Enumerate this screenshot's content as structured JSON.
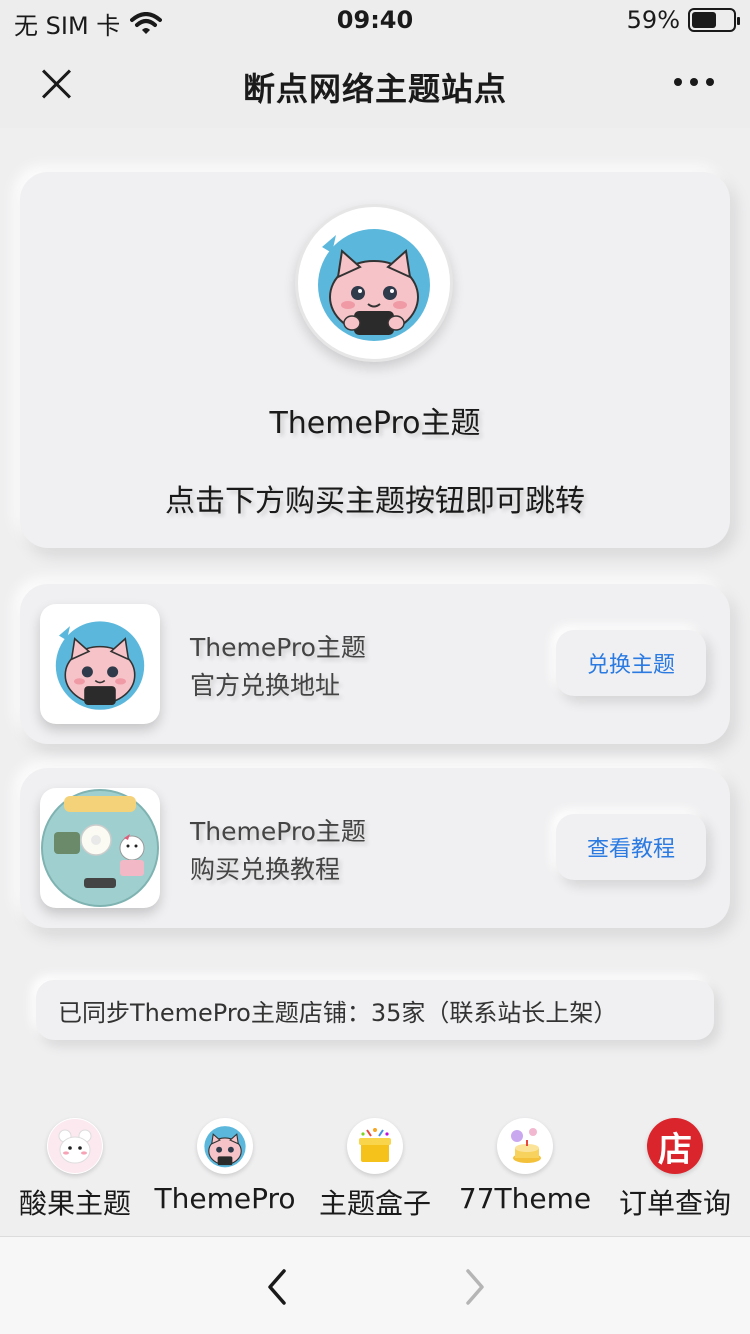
{
  "status_bar": {
    "carrier": "无 SIM 卡",
    "time": "09:40",
    "battery": "59%",
    "battery_level": 0.59
  },
  "nav": {
    "title": "断点网络主题站点"
  },
  "hero": {
    "name": "ThemePro主题",
    "description": "点击下方购买主题按钮即可跳转"
  },
  "items": [
    {
      "title": "ThemePro主题",
      "subtitle": "官方兑换地址",
      "button": "兑换主题",
      "thumb_icon": "cat-avatar-icon"
    },
    {
      "title": "ThemePro主题",
      "subtitle": "购买兑换教程",
      "button": "查看教程",
      "thumb_icon": "hello-kitty-disc-icon"
    }
  ],
  "sync_notice": "已同步ThemePro主题店铺：35家（联系站长上架）",
  "shops": [
    {
      "label": "酸果主题",
      "icon": "white-bear-icon"
    },
    {
      "label": "ThemePro",
      "icon": "cat-avatar-icon"
    },
    {
      "label": "主题盒子",
      "icon": "gift-box-icon"
    },
    {
      "label": "77Theme",
      "icon": "party-cake-icon"
    },
    {
      "label": "订单查询",
      "icon": "store-icon",
      "icon_text": "店",
      "icon_color": "#d9252b"
    }
  ],
  "toolbar": {
    "back_icon": "chevron-left-icon",
    "forward_icon": "chevron-right-icon"
  },
  "colors": {
    "accent": "#2a7ae2",
    "background": "#efeff0"
  }
}
